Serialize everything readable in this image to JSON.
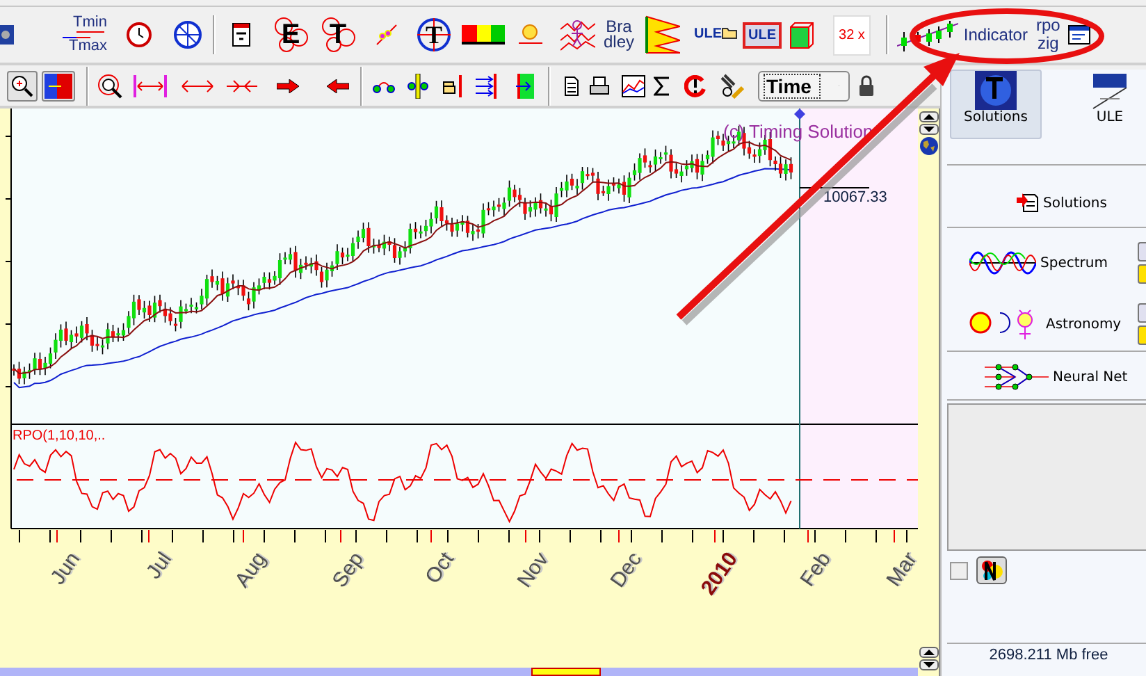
{
  "toolbar_top": {
    "tmin": "Tmin",
    "tmax": "Tmax",
    "e_label": "E",
    "t_label": "T",
    "t_circle_label": "T",
    "bradley": [
      "Bra",
      "dley"
    ],
    "ule_folder": "ULE",
    "ule_box": "ULE",
    "zoom_factor": "32 x",
    "indicator": "Indicator",
    "rpo_zig": [
      "rpo",
      "zig"
    ]
  },
  "toolbar_bottom": {
    "time_select": "Time"
  },
  "chart": {
    "copyright": "(c) Timing Solution",
    "price_label": "10067.33",
    "rpo_label": "RPO(1,10,10,..",
    "months": [
      {
        "label": "Jun",
        "kind": "month"
      },
      {
        "label": "Jul",
        "kind": "month"
      },
      {
        "label": "Aug",
        "kind": "month"
      },
      {
        "label": "Sep",
        "kind": "month"
      },
      {
        "label": "Oct",
        "kind": "month"
      },
      {
        "label": "Nov",
        "kind": "month"
      },
      {
        "label": "Dec",
        "kind": "month"
      },
      {
        "label": "2010",
        "kind": "year"
      },
      {
        "label": "Feb",
        "kind": "month"
      },
      {
        "label": "Mar",
        "kind": "month"
      }
    ]
  },
  "side_tabs": [
    {
      "label": "Solutions",
      "selected": true
    },
    {
      "label": "ULE",
      "selected": false
    }
  ],
  "side_panel": {
    "solutions": "Solutions",
    "spectrum": "Spectrum",
    "astronomy": "Astronomy",
    "neural_net": "Neural Net",
    "checkbox": {
      "checked": false
    },
    "memory": "2698.211 Mb free"
  }
}
